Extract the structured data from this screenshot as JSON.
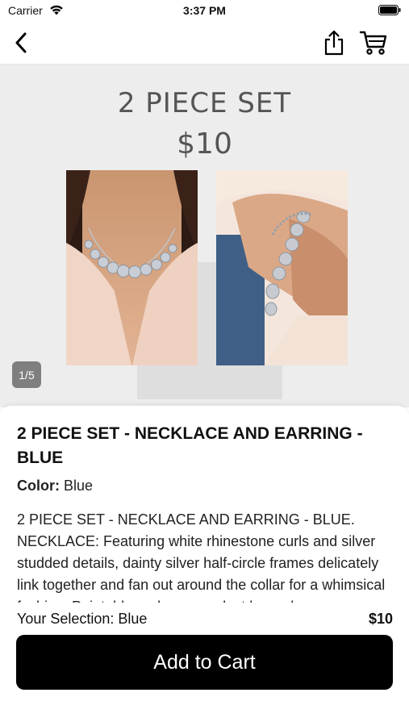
{
  "status_bar": {
    "carrier": "Carrier",
    "time": "3:37 PM",
    "icons": [
      "wifi-icon",
      "battery-icon"
    ]
  },
  "nav": {
    "icons": [
      "back-chevron-icon",
      "share-icon",
      "cart-icon"
    ]
  },
  "hero": {
    "promo_title": "2 PIECE SET",
    "promo_price": "$10",
    "image_counter": "1/5",
    "images": [
      "necklace-photo",
      "bracelet-photo"
    ]
  },
  "product": {
    "title": "2 PIECE SET - NECKLACE AND EARRING - BLUE",
    "color_label": "Color:",
    "color_value": "Blue",
    "description": "2 PIECE SET - NECKLACE AND EARRING - BLUE. NECKLACE:  Featuring white rhinestone curls and silver studded details, dainty silver half-circle frames delicately link together and fan out around the collar for a whimsical fashion. Pointable and zero product hazard"
  },
  "footer": {
    "selection_label": "Your Selection: Blue",
    "price": "$10",
    "add_to_cart_label": "Add to Cart"
  },
  "colors": {
    "hero_bg": "#ededed",
    "button_bg": "#000000",
    "button_text": "#ffffff",
    "promo_text": "#555555",
    "counter_bg": "#7f7f7f"
  }
}
